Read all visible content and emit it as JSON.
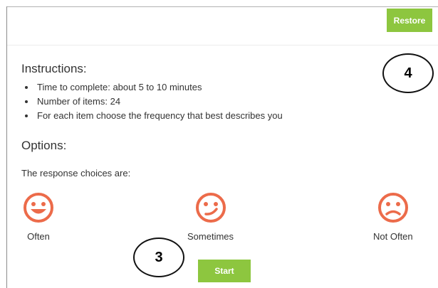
{
  "header": {
    "restore_label": "Restore"
  },
  "instructions": {
    "title": "Instructions:",
    "items": [
      "Time to complete: about 5 to 10 minutes",
      "Number of items: 24",
      "For each item choose the frequency that best describes you"
    ]
  },
  "options": {
    "title": "Options:",
    "intro": "The response choices are:",
    "choices": [
      {
        "label": "Often",
        "icon": "happy-face-icon"
      },
      {
        "label": "Sometimes",
        "icon": "uncertain-face-icon"
      },
      {
        "label": "Not Often",
        "icon": "sad-face-icon"
      }
    ]
  },
  "start_label": "Start",
  "callouts": {
    "restore": "4",
    "start": "3"
  },
  "colors": {
    "accent": "#8dc63f",
    "face": "#ec6b4a",
    "text": "#333333"
  }
}
